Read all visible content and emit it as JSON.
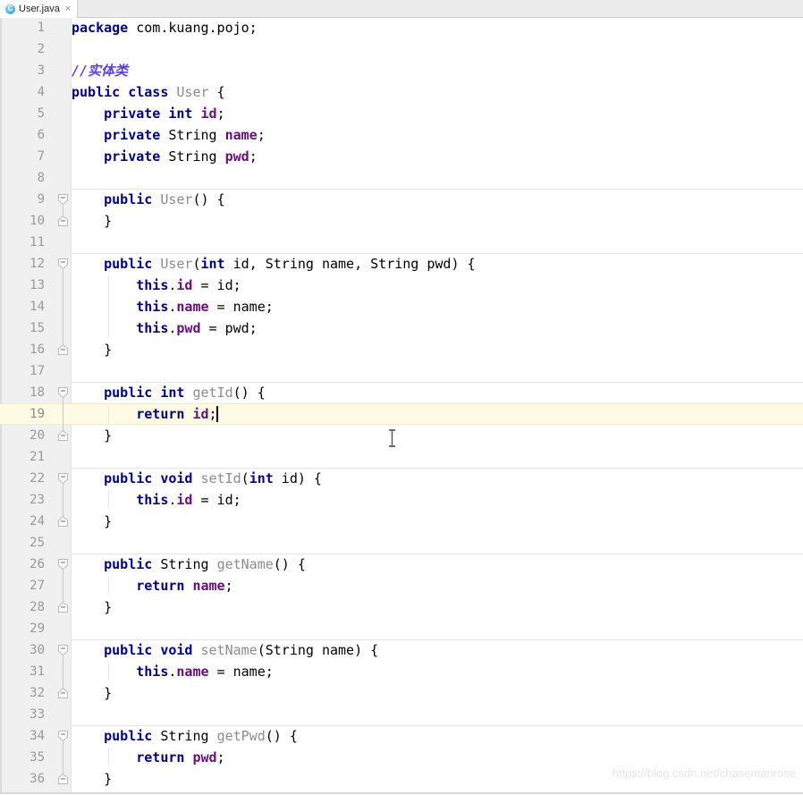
{
  "window": {
    "title": "User.java"
  },
  "tabbar": {
    "tabs": [
      {
        "label": "User.java",
        "icon": "java-class-icon",
        "icon_glyph": "C",
        "close_glyph": "×",
        "active": true
      }
    ]
  },
  "editor": {
    "language": "java",
    "current_line": 19,
    "caret": {
      "line": 19,
      "column": 18
    },
    "tab_size": 4,
    "colors": {
      "background": "#ffffff",
      "gutter_background": "#f0f0f0",
      "line_number": "#999999",
      "current_line_highlight": "#fffae3",
      "keyword": "#000080",
      "class_name": "#8c8c8c",
      "field": "#660e7a",
      "comment": "#5c41d9",
      "text": "#000000",
      "method_separator": "#e6e6e6",
      "indent_guide": "#e8e8e8"
    },
    "lines": [
      {
        "n": 1,
        "text": "package com.kuang.pojo;"
      },
      {
        "n": 2,
        "text": ""
      },
      {
        "n": 3,
        "text": "//实体类"
      },
      {
        "n": 4,
        "text": "public class User {"
      },
      {
        "n": 5,
        "text": "    private int id;"
      },
      {
        "n": 6,
        "text": "    private String name;"
      },
      {
        "n": 7,
        "text": "    private String pwd;"
      },
      {
        "n": 8,
        "text": ""
      },
      {
        "n": 9,
        "text": "    public User() {"
      },
      {
        "n": 10,
        "text": "    }"
      },
      {
        "n": 11,
        "text": ""
      },
      {
        "n": 12,
        "text": "    public User(int id, String name, String pwd) {"
      },
      {
        "n": 13,
        "text": "        this.id = id;"
      },
      {
        "n": 14,
        "text": "        this.name = name;"
      },
      {
        "n": 15,
        "text": "        this.pwd = pwd;"
      },
      {
        "n": 16,
        "text": "    }"
      },
      {
        "n": 17,
        "text": ""
      },
      {
        "n": 18,
        "text": "    public int getId() {"
      },
      {
        "n": 19,
        "text": "        return id;"
      },
      {
        "n": 20,
        "text": "    }"
      },
      {
        "n": 21,
        "text": ""
      },
      {
        "n": 22,
        "text": "    public void setId(int id) {"
      },
      {
        "n": 23,
        "text": "        this.id = id;"
      },
      {
        "n": 24,
        "text": "    }"
      },
      {
        "n": 25,
        "text": ""
      },
      {
        "n": 26,
        "text": "    public String getName() {"
      },
      {
        "n": 27,
        "text": "        return name;"
      },
      {
        "n": 28,
        "text": "    }"
      },
      {
        "n": 29,
        "text": ""
      },
      {
        "n": 30,
        "text": "    public void setName(String name) {"
      },
      {
        "n": 31,
        "text": "        this.name = name;"
      },
      {
        "n": 32,
        "text": "    }"
      },
      {
        "n": 33,
        "text": ""
      },
      {
        "n": 34,
        "text": "    public String getPwd() {"
      },
      {
        "n": 35,
        "text": "        return pwd;"
      },
      {
        "n": 36,
        "text": "    }"
      }
    ],
    "tokens": {
      "1": [
        [
          "kw",
          "package"
        ],
        [
          "plain",
          " com.kuang.pojo;"
        ]
      ],
      "3": [
        [
          "cmt",
          "//实体类"
        ]
      ],
      "4": [
        [
          "kw",
          "public class"
        ],
        [
          "plain",
          " "
        ],
        [
          "typ",
          "User"
        ],
        [
          "plain",
          " {"
        ]
      ],
      "5": [
        [
          "plain",
          "    "
        ],
        [
          "kw",
          "private int"
        ],
        [
          "plain",
          " "
        ],
        [
          "fld",
          "id"
        ],
        [
          "plain",
          ";"
        ]
      ],
      "6": [
        [
          "plain",
          "    "
        ],
        [
          "kw",
          "private"
        ],
        [
          "plain",
          " String "
        ],
        [
          "fld",
          "name"
        ],
        [
          "plain",
          ";"
        ]
      ],
      "7": [
        [
          "plain",
          "    "
        ],
        [
          "kw",
          "private"
        ],
        [
          "plain",
          " String "
        ],
        [
          "fld",
          "pwd"
        ],
        [
          "plain",
          ";"
        ]
      ],
      "9": [
        [
          "plain",
          "    "
        ],
        [
          "kw",
          "public"
        ],
        [
          "plain",
          " "
        ],
        [
          "typ",
          "User"
        ],
        [
          "plain",
          "() {"
        ]
      ],
      "10": [
        [
          "plain",
          "    }"
        ]
      ],
      "12": [
        [
          "plain",
          "    "
        ],
        [
          "kw",
          "public"
        ],
        [
          "plain",
          " "
        ],
        [
          "typ",
          "User"
        ],
        [
          "plain",
          "("
        ],
        [
          "kw",
          "int"
        ],
        [
          "plain",
          " id, String name, String pwd) {"
        ]
      ],
      "13": [
        [
          "plain",
          "        "
        ],
        [
          "kw",
          "this"
        ],
        [
          "plain",
          "."
        ],
        [
          "fld",
          "id"
        ],
        [
          "plain",
          " = id;"
        ]
      ],
      "14": [
        [
          "plain",
          "        "
        ],
        [
          "kw",
          "this"
        ],
        [
          "plain",
          "."
        ],
        [
          "fld",
          "name"
        ],
        [
          "plain",
          " = name;"
        ]
      ],
      "15": [
        [
          "plain",
          "        "
        ],
        [
          "kw",
          "this"
        ],
        [
          "plain",
          "."
        ],
        [
          "fld",
          "pwd"
        ],
        [
          "plain",
          " = pwd;"
        ]
      ],
      "16": [
        [
          "plain",
          "    }"
        ]
      ],
      "18": [
        [
          "plain",
          "    "
        ],
        [
          "kw",
          "public int"
        ],
        [
          "plain",
          " "
        ],
        [
          "typ",
          "getId"
        ],
        [
          "plain",
          "() {"
        ]
      ],
      "19": [
        [
          "plain",
          "        "
        ],
        [
          "kw",
          "return"
        ],
        [
          "plain",
          " "
        ],
        [
          "fld",
          "id"
        ],
        [
          "plain",
          ";"
        ]
      ],
      "20": [
        [
          "plain",
          "    }"
        ]
      ],
      "22": [
        [
          "plain",
          "    "
        ],
        [
          "kw",
          "public void"
        ],
        [
          "plain",
          " "
        ],
        [
          "typ",
          "setId"
        ],
        [
          "plain",
          "("
        ],
        [
          "kw",
          "int"
        ],
        [
          "plain",
          " id) {"
        ]
      ],
      "23": [
        [
          "plain",
          "        "
        ],
        [
          "kw",
          "this"
        ],
        [
          "plain",
          "."
        ],
        [
          "fld",
          "id"
        ],
        [
          "plain",
          " = id;"
        ]
      ],
      "24": [
        [
          "plain",
          "    }"
        ]
      ],
      "26": [
        [
          "plain",
          "    "
        ],
        [
          "kw",
          "public"
        ],
        [
          "plain",
          " String "
        ],
        [
          "typ",
          "getName"
        ],
        [
          "plain",
          "() {"
        ]
      ],
      "27": [
        [
          "plain",
          "        "
        ],
        [
          "kw",
          "return"
        ],
        [
          "plain",
          " "
        ],
        [
          "fld",
          "name"
        ],
        [
          "plain",
          ";"
        ]
      ],
      "28": [
        [
          "plain",
          "    }"
        ]
      ],
      "30": [
        [
          "plain",
          "    "
        ],
        [
          "kw",
          "public void"
        ],
        [
          "plain",
          " "
        ],
        [
          "typ",
          "setName"
        ],
        [
          "plain",
          "(String name) {"
        ]
      ],
      "31": [
        [
          "plain",
          "        "
        ],
        [
          "kw",
          "this"
        ],
        [
          "plain",
          "."
        ],
        [
          "fld",
          "name"
        ],
        [
          "plain",
          " = name;"
        ]
      ],
      "32": [
        [
          "plain",
          "    }"
        ]
      ],
      "34": [
        [
          "plain",
          "    "
        ],
        [
          "kw",
          "public"
        ],
        [
          "plain",
          " String "
        ],
        [
          "typ",
          "getPwd"
        ],
        [
          "plain",
          "() {"
        ]
      ],
      "35": [
        [
          "plain",
          "        "
        ],
        [
          "kw",
          "return"
        ],
        [
          "plain",
          " "
        ],
        [
          "fld",
          "pwd"
        ],
        [
          "plain",
          ";"
        ]
      ],
      "36": [
        [
          "plain",
          "    }"
        ]
      ]
    },
    "method_separator_lines": [
      9,
      12,
      18,
      22,
      26,
      30,
      34
    ],
    "fold_open_lines": [
      9,
      12,
      18,
      22,
      26,
      30,
      34
    ],
    "fold_close_lines": [
      10,
      16,
      20,
      24,
      28,
      32,
      36
    ],
    "indent_guides": [
      {
        "from": 13,
        "to": 15,
        "col": 4
      },
      {
        "from": 19,
        "to": 19,
        "col": 4
      },
      {
        "from": 23,
        "to": 23,
        "col": 4
      },
      {
        "from": 27,
        "to": 27,
        "col": 4
      },
      {
        "from": 31,
        "to": 31,
        "col": 4
      },
      {
        "from": 35,
        "to": 35,
        "col": 4
      }
    ]
  },
  "watermark": {
    "text": "https://blog.csdn.net/chasemanrose"
  }
}
